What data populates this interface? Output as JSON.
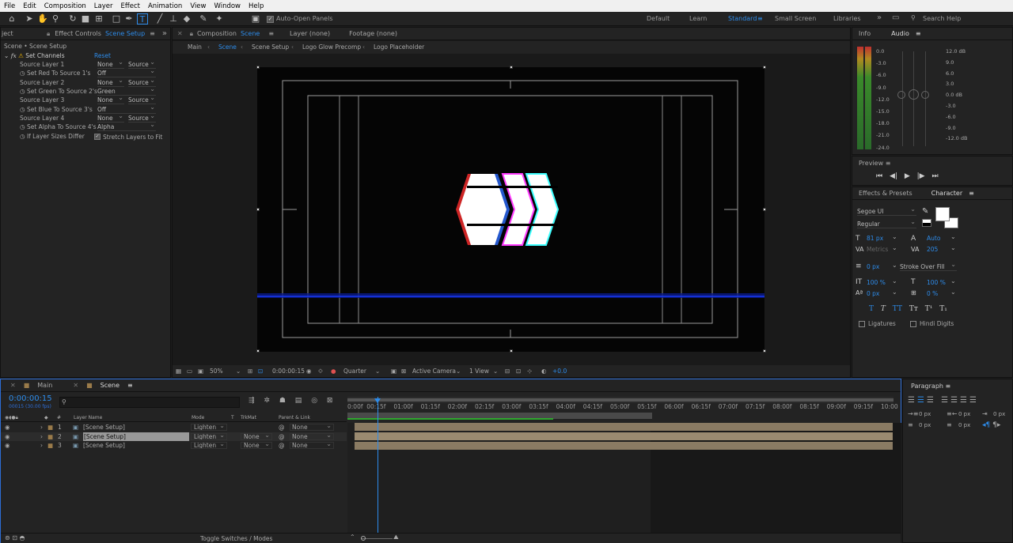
{
  "menu": [
    "File",
    "Edit",
    "Composition",
    "Layer",
    "Effect",
    "Animation",
    "View",
    "Window",
    "Help"
  ],
  "toolbar": {
    "auto_open_label": "Auto-Open Panels",
    "workspaces": [
      "Default",
      "Learn",
      "Standard",
      "Small Screen",
      "Libraries"
    ],
    "search_placeholder": "Search Help"
  },
  "effect_controls": {
    "left_tab": "ject",
    "tab_title": "Effect Controls",
    "tab_target": "Scene Setup",
    "breadcrumb": "Scene • Scene Setup",
    "effect_name": "Set Channels",
    "reset_label": "Reset",
    "rows": [
      {
        "label": "Source Layer 1",
        "value": "None",
        "value2": "Source"
      },
      {
        "label": "Set Red To Source 1's",
        "value": "Off"
      },
      {
        "label": "Source Layer 2",
        "value": "None",
        "value2": "Source"
      },
      {
        "label": "Set Green To Source 2's",
        "value": "Green"
      },
      {
        "label": "Source Layer 3",
        "value": "None",
        "value2": "Source"
      },
      {
        "label": "Set Blue To Source 3's",
        "value": "Off"
      },
      {
        "label": "Source Layer 4",
        "value": "None",
        "value2": "Source"
      },
      {
        "label": "Set Alpha To Source 4's",
        "value": "Alpha"
      }
    ],
    "size_label": "If Layer Sizes Differ",
    "stretch_label": "Stretch Layers to Fit"
  },
  "composition": {
    "tab_label": "Composition",
    "tab_name": "Scene",
    "layer_tab": "Layer (none)",
    "footage_tab": "Footage (none)",
    "breadcrumbs": [
      "Main",
      "Scene",
      "Scene Setup",
      "Logo Glow Precomp",
      "Logo Placeholder"
    ],
    "zoom": "50%",
    "timecode": "0:00:00:15",
    "resolution": "Quarter",
    "camera": "Active Camera",
    "view": "1 View",
    "exposure": "+0.0"
  },
  "info_panel": {
    "info_tab": "Info",
    "audio_tab": "Audio",
    "left_scale": [
      "0.0",
      "-3.0",
      "-6.0",
      "-9.0",
      "-12.0",
      "-15.0",
      "-18.0",
      "-21.0",
      "-24.0"
    ],
    "right_scale": [
      "12.0 dB",
      "9.0",
      "6.0",
      "3.0",
      "0.0 dB",
      "-3.0",
      "-6.0",
      "-9.0",
      "-12.0 dB"
    ]
  },
  "preview": {
    "title": "Preview"
  },
  "character": {
    "effects_tab": "Effects & Presets",
    "tab": "Character",
    "font": "Segoe UI",
    "style": "Regular",
    "font_size": "81 px",
    "leading": "Auto",
    "kerning": "Metrics",
    "tracking": "205",
    "stroke_width": "0 px",
    "stroke_mode": "Stroke Over Fill",
    "vscale": "100 %",
    "hscale": "100 %",
    "baseline": "0 px",
    "tsume": "0 %",
    "style_buttons": [
      "T",
      "T",
      "TT",
      "Tт",
      "T¹",
      "T₁"
    ],
    "ligatures": "Ligatures",
    "hindi_digits": "Hindi Digits"
  },
  "paragraph": {
    "title": "Paragraph",
    "vals": [
      "0 px",
      "0 px",
      "0 px",
      "0 px",
      "0 px"
    ]
  },
  "timeline": {
    "tabs": [
      "Main",
      "Scene"
    ],
    "timecode": "0:00:00:15",
    "frames": "00015 (30.00 fps)",
    "col_layer": "Layer Name",
    "col_mode": "Mode",
    "col_t": "T",
    "col_trkmat": "TrkMat",
    "col_parent": "Parent & Link",
    "ruler": [
      "0:00f",
      "00:15f",
      "01:00f",
      "01:15f",
      "02:00f",
      "02:15f",
      "03:00f",
      "03:15f",
      "04:00f",
      "04:15f",
      "05:00f",
      "05:15f",
      "06:00f",
      "06:15f",
      "07:00f",
      "07:15f",
      "08:00f",
      "08:15f",
      "09:00f",
      "09:15f",
      "10:00"
    ],
    "layers": [
      {
        "num": "1",
        "name": "[Scene Setup]",
        "mode": "Lighten",
        "trkmat": "",
        "parent": "None"
      },
      {
        "num": "2",
        "name": "[Scene Setup]",
        "mode": "Lighten",
        "trkmat": "None",
        "parent": "None"
      },
      {
        "num": "3",
        "name": "[Scene Setup]",
        "mode": "Lighten",
        "trkmat": "None",
        "parent": "None"
      }
    ],
    "toggle_label": "Toggle Switches / Modes"
  }
}
